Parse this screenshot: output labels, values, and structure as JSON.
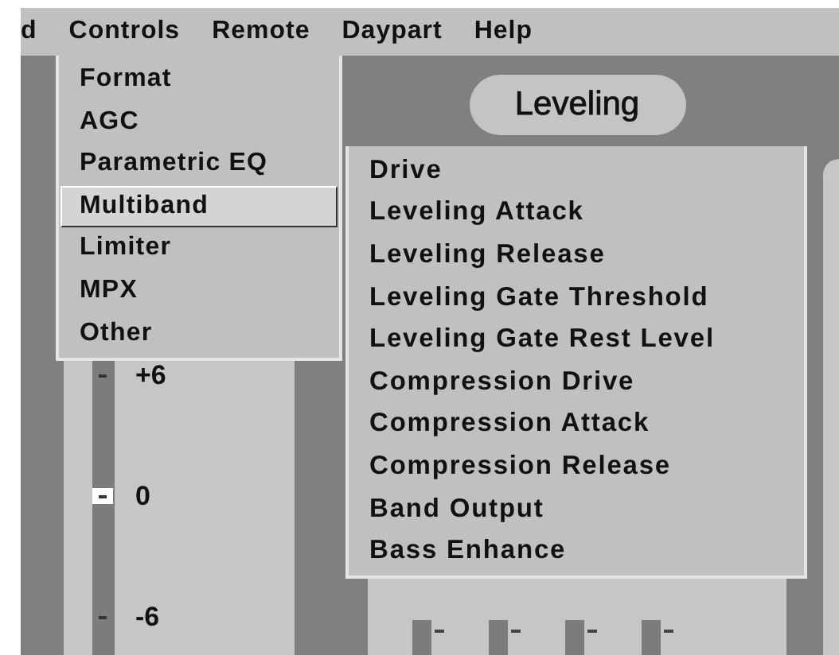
{
  "menu_bar": [
    {
      "label": "d"
    },
    {
      "label": "Controls",
      "items": [
        {
          "label": "Format",
          "selected": false
        },
        {
          "label": "AGC",
          "selected": false
        },
        {
          "label": "Parametric EQ",
          "selected": false
        },
        {
          "label": "Multiband",
          "selected": true,
          "items": [
            {
              "label": "Drive"
            },
            {
              "label": "Leveling Attack"
            },
            {
              "label": "Leveling Release"
            },
            {
              "label": "Leveling Gate Threshold"
            },
            {
              "label": "Leveling Gate Rest Level"
            },
            {
              "label": "Compression Drive"
            },
            {
              "label": "Compression Attack"
            },
            {
              "label": "Compression Release"
            },
            {
              "label": "Band Output"
            },
            {
              "label": "Bass Enhance"
            }
          ]
        },
        {
          "label": "Limiter",
          "selected": false
        },
        {
          "label": "MPX",
          "selected": false
        },
        {
          "label": "Other",
          "selected": false
        }
      ]
    },
    {
      "label": "Remote"
    },
    {
      "label": "Daypart"
    },
    {
      "label": "Help"
    }
  ],
  "section_title": "Leveling",
  "slider": {
    "level": 0.32,
    "scale": [
      "+6",
      "0",
      "-6"
    ]
  }
}
